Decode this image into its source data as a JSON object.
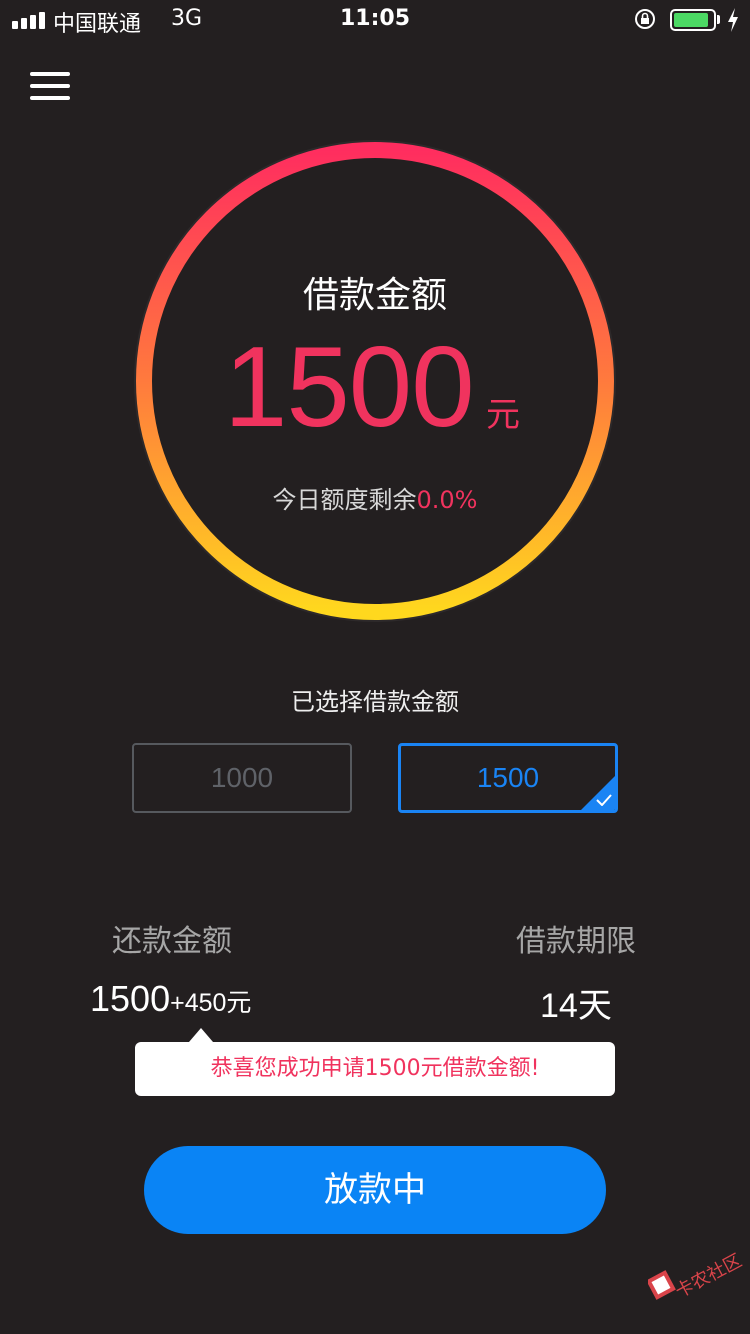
{
  "status_bar": {
    "carrier": "中国联通",
    "network": "3G",
    "time": "11:05",
    "battery_level": 0.85,
    "icons": [
      "signal-icon",
      "orientation-lock-icon",
      "battery-icon",
      "charging-bolt-icon"
    ]
  },
  "header": {
    "menu_icon": "hamburger-menu-icon"
  },
  "loan_ring": {
    "title": "借款金额",
    "amount": "1500",
    "unit": "元",
    "remaining_label": "今日额度剩余",
    "remaining_value": "0.0%",
    "gradient_colors": [
      "#ff2d5f",
      "#ffd81e"
    ]
  },
  "amount_selector": {
    "label": "已选择借款金额",
    "options": [
      {
        "value": "1000",
        "selected": false
      },
      {
        "value": "1500",
        "selected": true
      }
    ],
    "accent_color": "#1a84f4"
  },
  "summary": {
    "repay_label": "还款金额",
    "repay_main": "1500",
    "repay_extra": "+450元",
    "term_label": "借款期限",
    "term_value": "14天"
  },
  "tooltip": {
    "message": "恭喜您成功申请1500元借款金额!"
  },
  "action": {
    "button_label": "放款中",
    "button_color": "#0a84f5"
  },
  "watermark": {
    "text": "卡农社区"
  }
}
